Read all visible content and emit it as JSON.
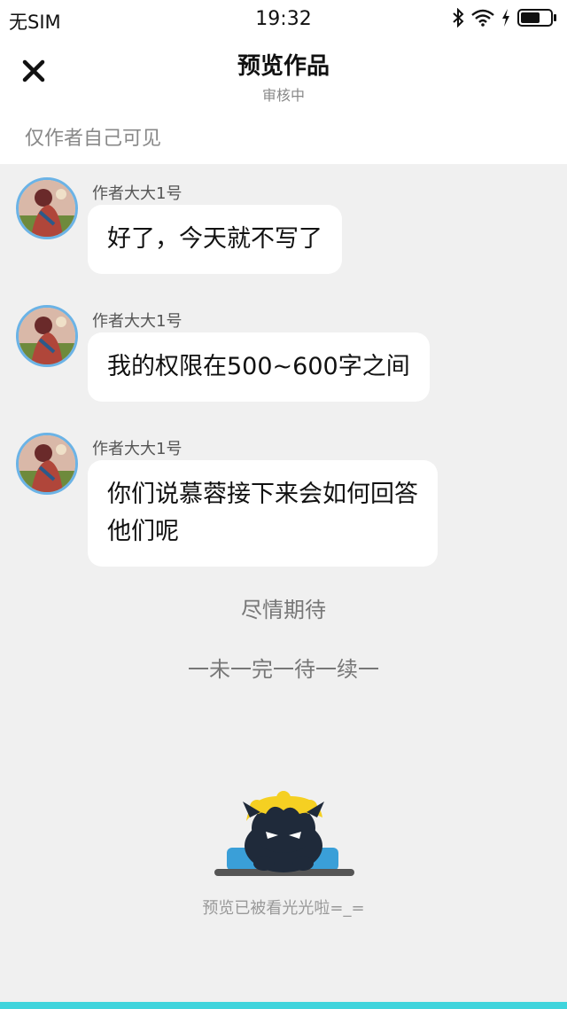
{
  "status_bar": {
    "carrier": "无SIM",
    "time": "19:32",
    "icons": [
      "bluetooth-icon",
      "wifi-icon",
      "charging-bolt-icon",
      "battery-icon"
    ]
  },
  "nav": {
    "close_icon": "close-icon",
    "title": "预览作品",
    "subtitle": "审核中"
  },
  "visibility_note": "仅作者自己可见",
  "messages": [
    {
      "author": "作者大大1号",
      "lines": [
        "好了，今天就不写了"
      ]
    },
    {
      "author": "作者大大1号",
      "lines": [
        "我的权限在500~600字之间"
      ]
    },
    {
      "author": "作者大大1号",
      "lines": [
        "你们说慕蓉接下来会如何回答",
        "他们呢"
      ]
    }
  ],
  "ending": {
    "teaser": "尽情期待",
    "tbc": "一未一完一待一续一"
  },
  "footer": {
    "mascot_icon": "mascot-icon",
    "text": "预览已被看光光啦=_="
  },
  "colors": {
    "background": "#f0f0f0",
    "avatar_ring": "#6bb3e6",
    "bottom_accent": "#3fd4dc"
  }
}
